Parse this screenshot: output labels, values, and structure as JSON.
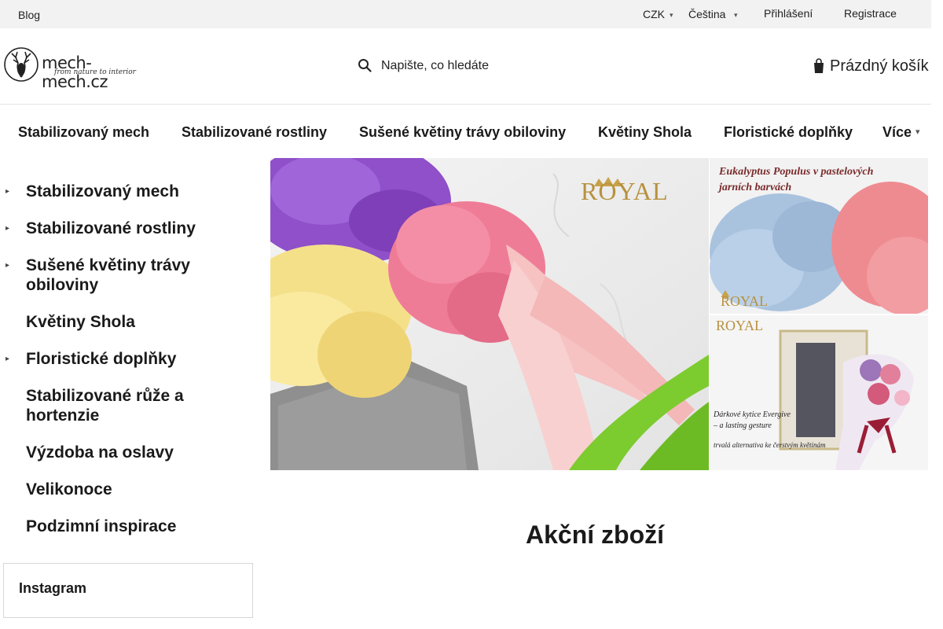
{
  "topbar": {
    "blog": "Blog",
    "currency": "CZK",
    "language": "Čeština",
    "login": "Přihlášení",
    "register": "Registrace"
  },
  "header": {
    "logo_text": "mech-mech.cz",
    "logo_tagline": "from nature to interior",
    "search_placeholder": "Napište, co hledáte",
    "cart_label": "Prázdný košík"
  },
  "nav": {
    "items": [
      "Stabilizovaný mech",
      "Stabilizované rostliny",
      "Sušené květiny trávy obiloviny",
      "Květiny Shola",
      "Floristické doplňky"
    ],
    "more": "Více"
  },
  "sidebar": {
    "categories": [
      {
        "label": "Stabilizovaný mech",
        "has_children": true
      },
      {
        "label": "Stabilizované rostliny",
        "has_children": true
      },
      {
        "label": "Sušené květiny trávy obiloviny",
        "has_children": true
      },
      {
        "label": "Květiny Shola",
        "has_children": false
      },
      {
        "label": "Floristické doplňky",
        "has_children": true
      },
      {
        "label": "Stabilizované růže a hortenzie",
        "has_children": false
      },
      {
        "label": "Výzdoba na oslavy",
        "has_children": false
      },
      {
        "label": "Velikonoce",
        "has_children": false
      },
      {
        "label": "Podzimní inspirace",
        "has_children": false
      }
    ],
    "instagram_title": "Instagram"
  },
  "banners": {
    "main_brand": "ROYAL",
    "r1_title_line1": "Eukalyptus Populus v pastelových",
    "r1_title_line2": "jarních barvách",
    "r1_brand": "ROYAL",
    "r2_brand": "ROYAL",
    "r2_line1": "Dárkové kytice Evergive",
    "r2_line2": "– a lasting gesture",
    "r2_line3": "trvalá alternativa ke čerstvým květinám"
  },
  "section": {
    "title": "Akční zboží"
  }
}
